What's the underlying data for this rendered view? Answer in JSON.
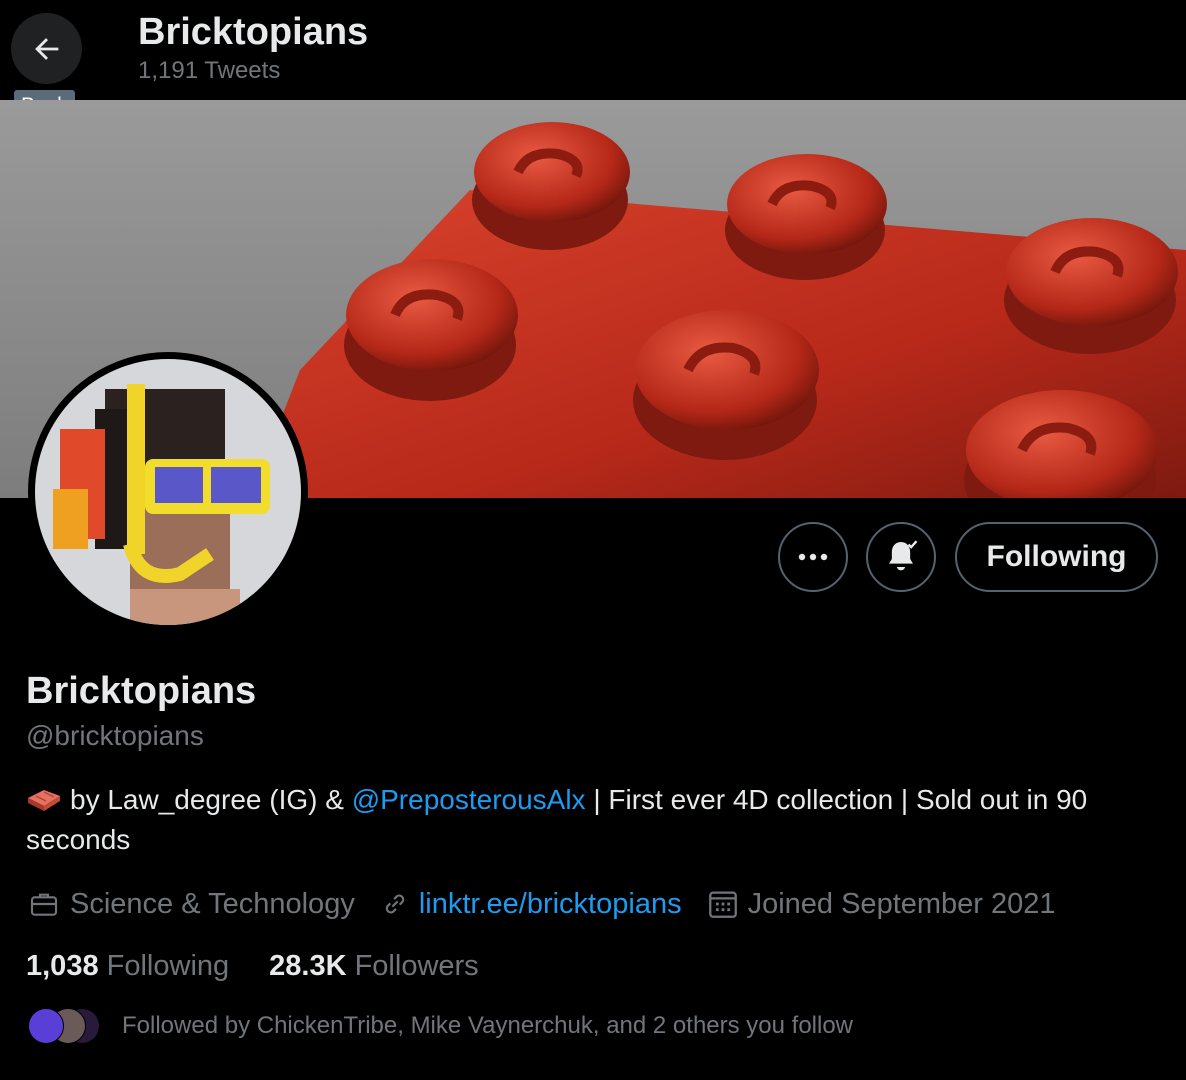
{
  "header": {
    "title": "Bricktopians",
    "tweet_count": "1,191 Tweets",
    "back_tooltip": "Back"
  },
  "profile": {
    "display_name": "Bricktopians",
    "handle": "@bricktopians",
    "bio_prefix": "by Law_degree (IG) & ",
    "bio_mention": "@PreposterousAlx",
    "bio_suffix": " | First ever 4D collection | Sold out in 90 seconds",
    "category": "Science & Technology",
    "link": "linktr.ee/bricktopians",
    "joined": "Joined September 2021"
  },
  "actions": {
    "more_icon": "more-icon",
    "notify_icon": "bell-check-icon",
    "follow_label": "Following"
  },
  "stats": {
    "following_count": "1,038",
    "following_label": "Following",
    "followers_count": "28.3K",
    "followers_label": "Followers"
  },
  "followed_by": "Followed by ChickenTribe, Mike Vaynerchuk, and 2 others you follow",
  "colors": {
    "accent": "#1d9bf0",
    "background": "#000000",
    "muted": "#71767b",
    "banner_brick": "#c9311f"
  }
}
